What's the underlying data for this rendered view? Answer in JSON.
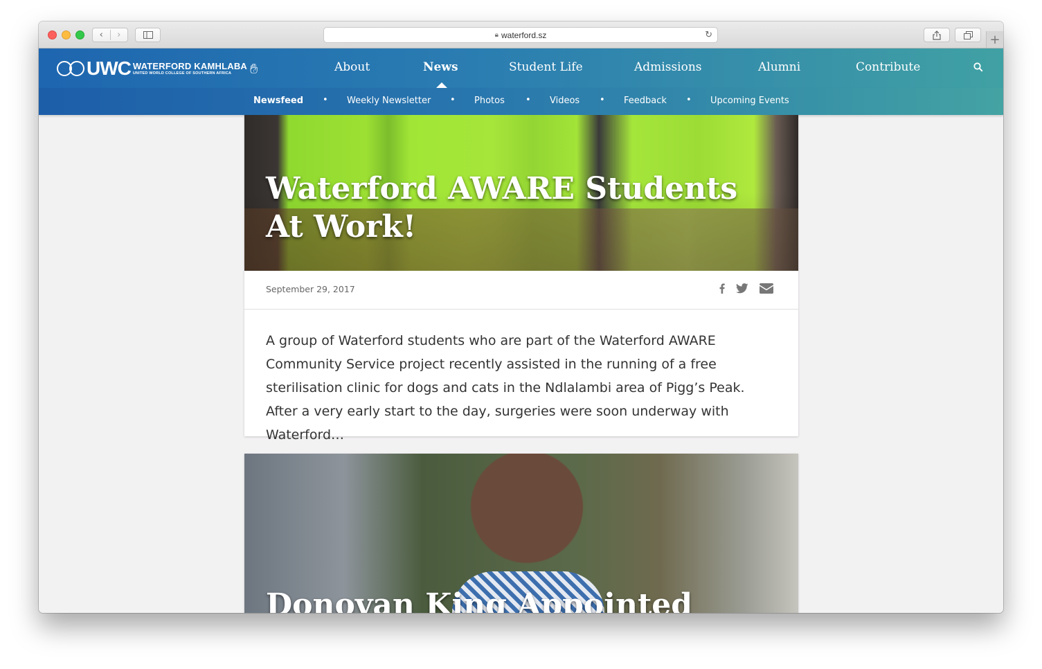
{
  "browser": {
    "url": "waterford.sz"
  },
  "site": {
    "logo_uwc": "UWC",
    "logo_name": "WATERFORD KAMHLABA",
    "logo_subtitle": "UNITED WORLD COLLEGE OF SOUTHERN AFRICA",
    "nav": [
      {
        "label": "About"
      },
      {
        "label": "News"
      },
      {
        "label": "Student Life"
      },
      {
        "label": "Admissions"
      },
      {
        "label": "Alumni"
      },
      {
        "label": "Contribute"
      }
    ],
    "active_nav": "News",
    "subnav": [
      {
        "label": "Newsfeed"
      },
      {
        "label": "Weekly Newsletter"
      },
      {
        "label": "Photos"
      },
      {
        "label": "Videos"
      },
      {
        "label": "Feedback"
      },
      {
        "label": "Upcoming Events"
      }
    ],
    "active_subnav": "Newsfeed",
    "separator": "•"
  },
  "articles": [
    {
      "title": "Waterford AWARE Students At Work!",
      "date": "September 29, 2017",
      "excerpt": "A group of Waterford students who are part of the Waterford AWARE Community Service project recently assisted in the running of a free sterilisation clinic for dogs and cats in the Ndlalambi area of Pigg’s Peak. After a very early start to the day, surgeries were soon underway with Waterford…",
      "share": [
        "facebook-icon",
        "twitter-icon",
        "email-icon"
      ]
    },
    {
      "title": "Donovan King Appointed"
    }
  ],
  "colors": {
    "header_start": "#1e66b0",
    "header_end": "#40a1a4",
    "page_bg": "#f3f2f3"
  }
}
